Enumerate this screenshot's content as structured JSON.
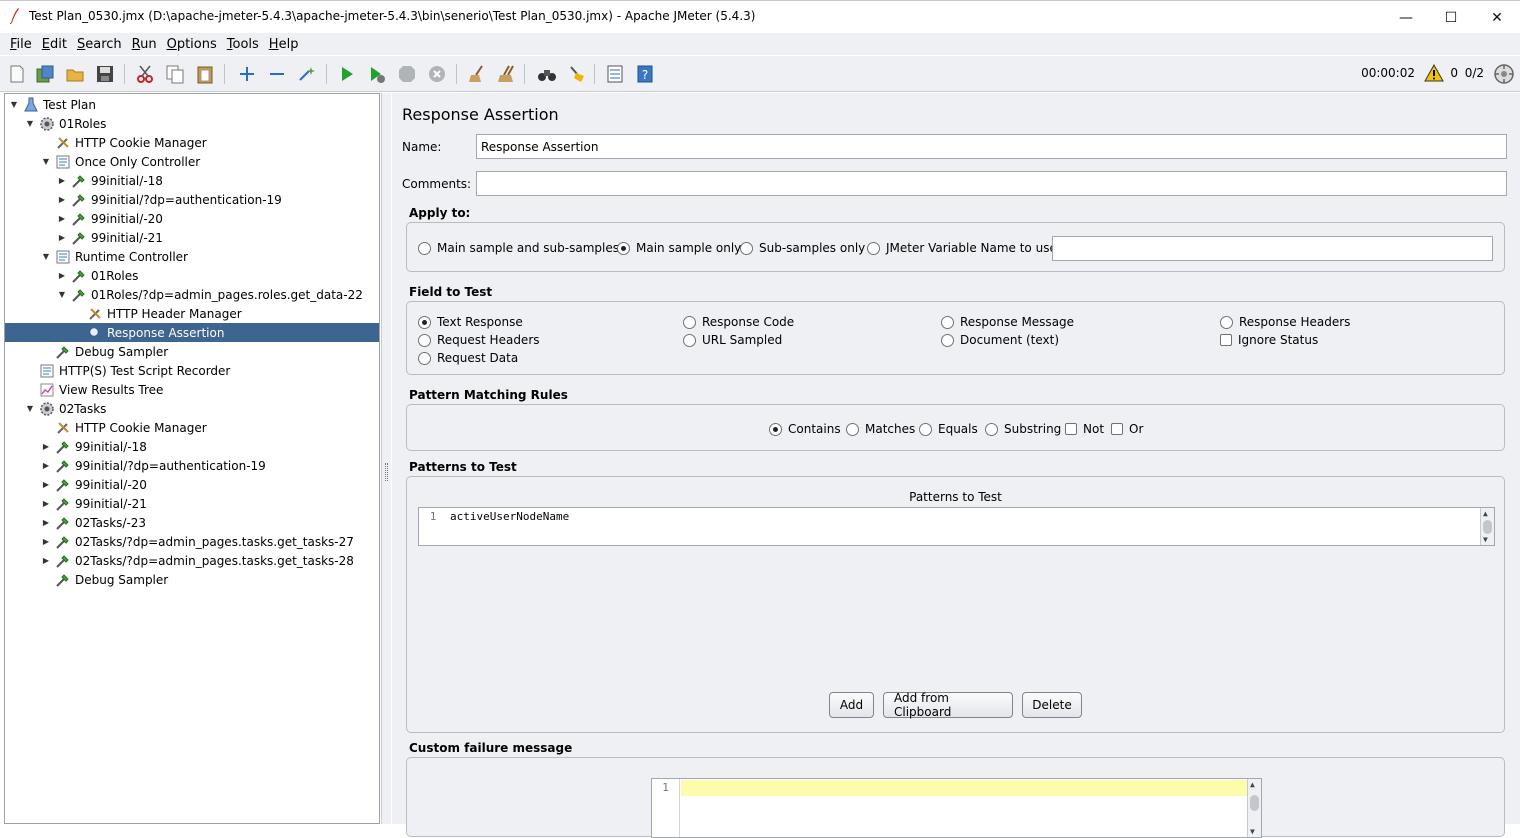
{
  "window": {
    "title": "Test Plan_0530.jmx (D:\\apache-jmeter-5.4.3\\apache-jmeter-5.4.3\\bin\\senerio\\Test Plan_0530.jmx) - Apache JMeter (5.4.3)",
    "minimize": "—",
    "maximize": "☐",
    "close": "✕"
  },
  "menu": [
    {
      "mn": "F",
      "rest": "ile"
    },
    {
      "mn": "E",
      "rest": "dit"
    },
    {
      "mn": "S",
      "rest": "earch"
    },
    {
      "mn": "R",
      "rest": "un"
    },
    {
      "mn": "O",
      "rest": "ptions"
    },
    {
      "mn": "T",
      "rest": "ools"
    },
    {
      "mn": "H",
      "rest": "elp"
    }
  ],
  "run_status": {
    "elapsed": "00:00:02",
    "warnings": "0",
    "threads": "0/2"
  },
  "tree": [
    {
      "label": "Test Plan",
      "icon": "flask-icon",
      "expander": "▼"
    },
    {
      "label": "01Roles",
      "icon": "gear-icon",
      "expander": "▼"
    },
    {
      "label": "HTTP Cookie Manager",
      "icon": "wrench-icon",
      "expander": ""
    },
    {
      "label": "Once Only Controller",
      "icon": "controller-icon",
      "expander": "▼"
    },
    {
      "label": "99initial/-18",
      "icon": "pipette-icon",
      "expander": "▶"
    },
    {
      "label": "99initial/?dp=authentication-19",
      "icon": "pipette-icon",
      "expander": "▶"
    },
    {
      "label": "99initial/-20",
      "icon": "pipette-icon",
      "expander": "▶"
    },
    {
      "label": "99initial/-21",
      "icon": "pipette-icon",
      "expander": "▶"
    },
    {
      "label": "Runtime Controller",
      "icon": "controller-icon",
      "expander": "▼"
    },
    {
      "label": "01Roles",
      "icon": "pipette-icon",
      "expander": "▶"
    },
    {
      "label": "01Roles/?dp=admin_pages.roles.get_data-22",
      "icon": "pipette-icon",
      "expander": "▼"
    },
    {
      "label": "HTTP Header Manager",
      "icon": "wrench-icon",
      "expander": ""
    },
    {
      "label": "Response Assertion",
      "icon": "magnifier-icon",
      "expander": ""
    },
    {
      "label": "Debug Sampler",
      "icon": "pipette-icon",
      "expander": ""
    },
    {
      "label": "HTTP(S) Test Script Recorder",
      "icon": "controller-icon",
      "expander": ""
    },
    {
      "label": "View Results Tree",
      "icon": "chart-icon",
      "expander": ""
    },
    {
      "label": "02Tasks",
      "icon": "gear-icon",
      "expander": "▼"
    },
    {
      "label": "HTTP Cookie Manager",
      "icon": "wrench-icon",
      "expander": ""
    },
    {
      "label": "99initial/-18",
      "icon": "pipette-icon",
      "expander": "▶"
    },
    {
      "label": "99initial/?dp=authentication-19",
      "icon": "pipette-icon",
      "expander": "▶"
    },
    {
      "label": "99initial/-20",
      "icon": "pipette-icon",
      "expander": "▶"
    },
    {
      "label": "99initial/-21",
      "icon": "pipette-icon",
      "expander": "▶"
    },
    {
      "label": "02Tasks/-23",
      "icon": "pipette-icon",
      "expander": "▶"
    },
    {
      "label": "02Tasks/?dp=admin_pages.tasks.get_tasks-27",
      "icon": "pipette-icon",
      "expander": "▶"
    },
    {
      "label": "02Tasks/?dp=admin_pages.tasks.get_tasks-28",
      "icon": "pipette-icon",
      "expander": "▶"
    },
    {
      "label": "Debug Sampler",
      "icon": "pipette-icon",
      "expander": ""
    }
  ],
  "selected_tree_item": "Response Assertion",
  "editor": {
    "title": "Response Assertion",
    "name_label": "Name:",
    "name_value": "Response Assertion",
    "comments_label": "Comments:",
    "comments_value": "",
    "apply_to": {
      "title": "Apply to:",
      "options": [
        {
          "label": "Main sample and sub-samples",
          "checked": false
        },
        {
          "label": "Main sample only",
          "checked": true
        },
        {
          "label": "Sub-samples only",
          "checked": false
        },
        {
          "label": "JMeter Variable Name to use",
          "checked": false
        }
      ],
      "variable_value": ""
    },
    "field_to_test": {
      "title": "Field to Test",
      "options": [
        {
          "label": "Text Response",
          "type": "radio",
          "checked": true
        },
        {
          "label": "Response Code",
          "type": "radio",
          "checked": false
        },
        {
          "label": "Response Message",
          "type": "radio",
          "checked": false
        },
        {
          "label": "Response Headers",
          "type": "radio",
          "checked": false
        },
        {
          "label": "Request Headers",
          "type": "radio",
          "checked": false
        },
        {
          "label": "URL Sampled",
          "type": "radio",
          "checked": false
        },
        {
          "label": "Document (text)",
          "type": "radio",
          "checked": false
        },
        {
          "label": "Ignore Status",
          "type": "checkbox",
          "checked": false
        },
        {
          "label": "Request Data",
          "type": "radio",
          "checked": false
        }
      ]
    },
    "pattern_matching": {
      "title": "Pattern Matching Rules",
      "options": [
        {
          "label": "Contains",
          "type": "radio",
          "checked": true
        },
        {
          "label": "Matches",
          "type": "radio",
          "checked": false
        },
        {
          "label": "Equals",
          "type": "radio",
          "checked": false
        },
        {
          "label": "Substring",
          "type": "radio",
          "checked": false
        },
        {
          "label": "Not",
          "type": "checkbox",
          "checked": false
        },
        {
          "label": "Or",
          "type": "checkbox",
          "checked": false
        }
      ]
    },
    "patterns": {
      "title": "Patterns to Test",
      "table_header": "Patterns to Test",
      "rows": [
        {
          "line": "1",
          "value": "activeUserNodeName"
        }
      ],
      "buttons": {
        "add": "Add",
        "add_clipboard": "Add from Clipboard",
        "delete": "Delete"
      }
    },
    "custom_failure": {
      "title": "Custom failure message",
      "line": "1",
      "value": ""
    }
  },
  "colors": {
    "selection": "#3e6590",
    "panel_bg": "#eef0f4",
    "highlight_line": "#fdfbac"
  }
}
